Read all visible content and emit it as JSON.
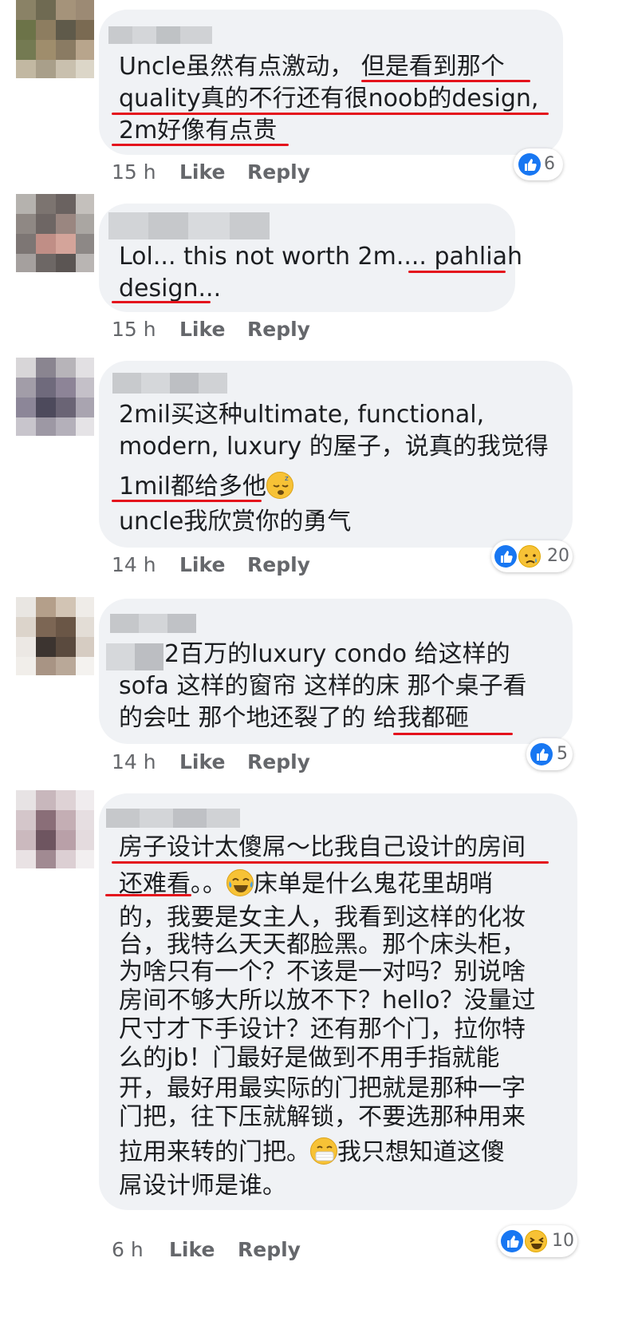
{
  "comments": [
    {
      "lines": [
        "Uncle虽然有点激动， 但是看到那个",
        "quality真的不行还有很noob的design,",
        "2m好像有点贵"
      ],
      "time": "15 h",
      "like": "Like",
      "reply": "Reply",
      "reactions": {
        "types": [
          "like-icon"
        ],
        "count": "6"
      }
    },
    {
      "lines": [
        "Lol... this not worth 2m.... pahliah",
        "design..."
      ],
      "time": "15 h",
      "like": "Like",
      "reply": "Reply",
      "reactions": null
    },
    {
      "lines": [
        "2mil买这种ultimate, functional,",
        "modern, luxury 的屋子，说真的我觉得",
        "1mil都给多他",
        "uncle我欣赏你的勇气"
      ],
      "time": "14 h",
      "like": "Like",
      "reply": "Reply",
      "reactions": {
        "types": [
          "like-icon",
          "sad-face-icon"
        ],
        "count": "20"
      }
    },
    {
      "lines": [
        "2百万的luxury condo  给这样的",
        "sofa 这样的窗帘 这样的床  那个桌子看",
        "的会吐  那个地还裂了的  给我都砸"
      ],
      "time": "14 h",
      "like": "Like",
      "reply": "Reply",
      "reactions": {
        "types": [
          "like-icon"
        ],
        "count": "5"
      }
    },
    {
      "lines": [
        "房子设计太傻屌～比我自己设计的房间",
        "还难看。。",
        "床单是什么鬼花里胡哨",
        "的，我要是女主人，我看到这样的化妆",
        "台，我特么天天都脸黑。那个床头柜，",
        "为啥只有一个？不该是一对吗？别说啥",
        "房间不够大所以放不下？hello？没量过",
        "尺寸才下手设计？还有那个门，拉你特",
        "么的jb！门最好是做到不用手指就能",
        "开，最好用最实际的门把就是那种一字",
        "门把，往下压就解锁，不要选那种用来",
        "拉用来转的门把。",
        "我只想知道这傻",
        "屌设计师是谁。"
      ],
      "time": "6 h",
      "like": "Like",
      "reply": "Reply",
      "reactions": {
        "types": [
          "like-icon",
          "laughing-squint-icon"
        ],
        "count": "10"
      }
    }
  ],
  "colors": {
    "underline": "#e4121c",
    "like_blue": "#1877f2",
    "bubble": "#f0f2f5",
    "meta_gray": "#65676b"
  },
  "inline_emojis": [
    "sleeping-face-emoji",
    "tears-of-joy-emoji",
    "mask-face-emoji"
  ]
}
